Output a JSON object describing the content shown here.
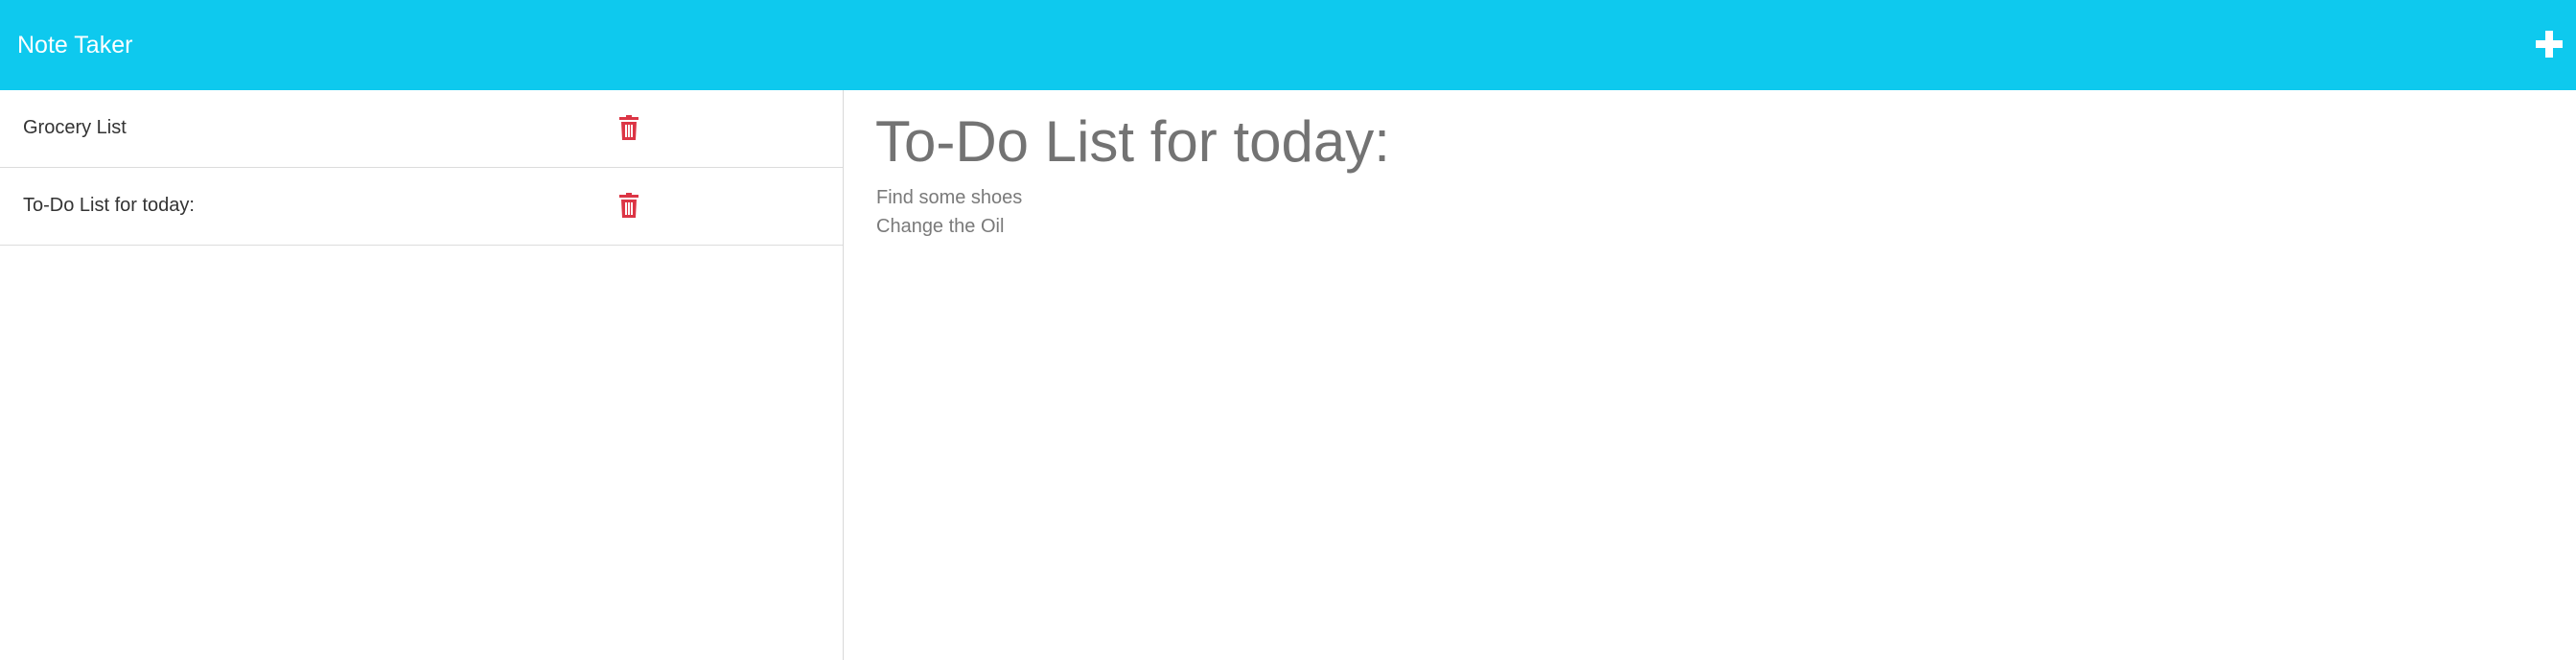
{
  "navbar": {
    "brand": "Note Taker",
    "add_icon": "plus-icon"
  },
  "sidebar": {
    "notes": [
      {
        "title": "Grocery List",
        "delete_icon": "trash-icon"
      },
      {
        "title": "To-Do List for today:",
        "delete_icon": "trash-icon"
      }
    ]
  },
  "editor": {
    "title": "To-Do List for today:",
    "lines": [
      "Find some shoes",
      "Change the Oil"
    ]
  },
  "colors": {
    "navbar_bg": "#0ec9ee",
    "delete_red": "#dc3545",
    "heading_gray": "#737373"
  }
}
